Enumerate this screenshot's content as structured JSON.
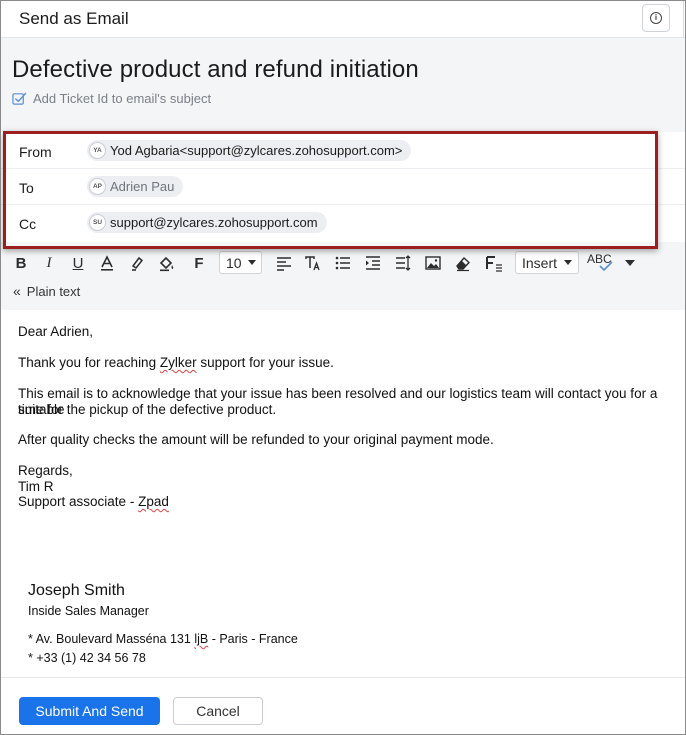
{
  "window": {
    "title": "Send as Email"
  },
  "header": {
    "subject": "Defective product and refund initiation",
    "ticket_option_label": "Add Ticket Id to email's subject"
  },
  "recipients": {
    "from": {
      "label": "From",
      "initials": "YA",
      "value": "Yod Agbaria<support@zylcares.zohosupport.com>"
    },
    "to": {
      "label": "To",
      "initials": "AP",
      "value": "Adrien Pau"
    },
    "cc": {
      "label": "Cc",
      "initials": "SU",
      "value": "support@zylcares.zohosupport.com"
    }
  },
  "toolbar": {
    "bold": "B",
    "italic": "I",
    "underline": "U",
    "font_family": "F",
    "font_size": "10",
    "insert_label": "Insert",
    "spellcheck": "ABC",
    "plain_text_label": "Plain text"
  },
  "email_body": {
    "greeting": "Dear Adrien,",
    "line1_pre": "Thank you for reaching ",
    "line1_brand": "Zylker",
    "line1_post": " support for your issue.",
    "line2": "This email is to acknowledge that your issue has been resolved and our logistics team will contact you for a suitable",
    "line3": "time for the pickup of the defective product.",
    "line4": "After quality checks the amount will be refunded to your original payment mode.",
    "regards": "Regards,",
    "sender": "Tim R",
    "role_pre": "Support associate - ",
    "role_brand": "Zpad"
  },
  "signature": {
    "name": "Joseph Smith",
    "title": "Inside Sales Manager",
    "address_pre": "* Av. Boulevard Masséna 131 ",
    "address_mid": "ljB",
    "address_post": " - Paris - France",
    "phone": "* +33 (1) 42 34 56 78"
  },
  "footer": {
    "submit_label": "Submit And Send",
    "cancel_label": "Cancel"
  },
  "colors": {
    "primary": "#1a73e8",
    "highlight_border": "#9b1f1f",
    "panel_bg": "#f4f5f7"
  }
}
